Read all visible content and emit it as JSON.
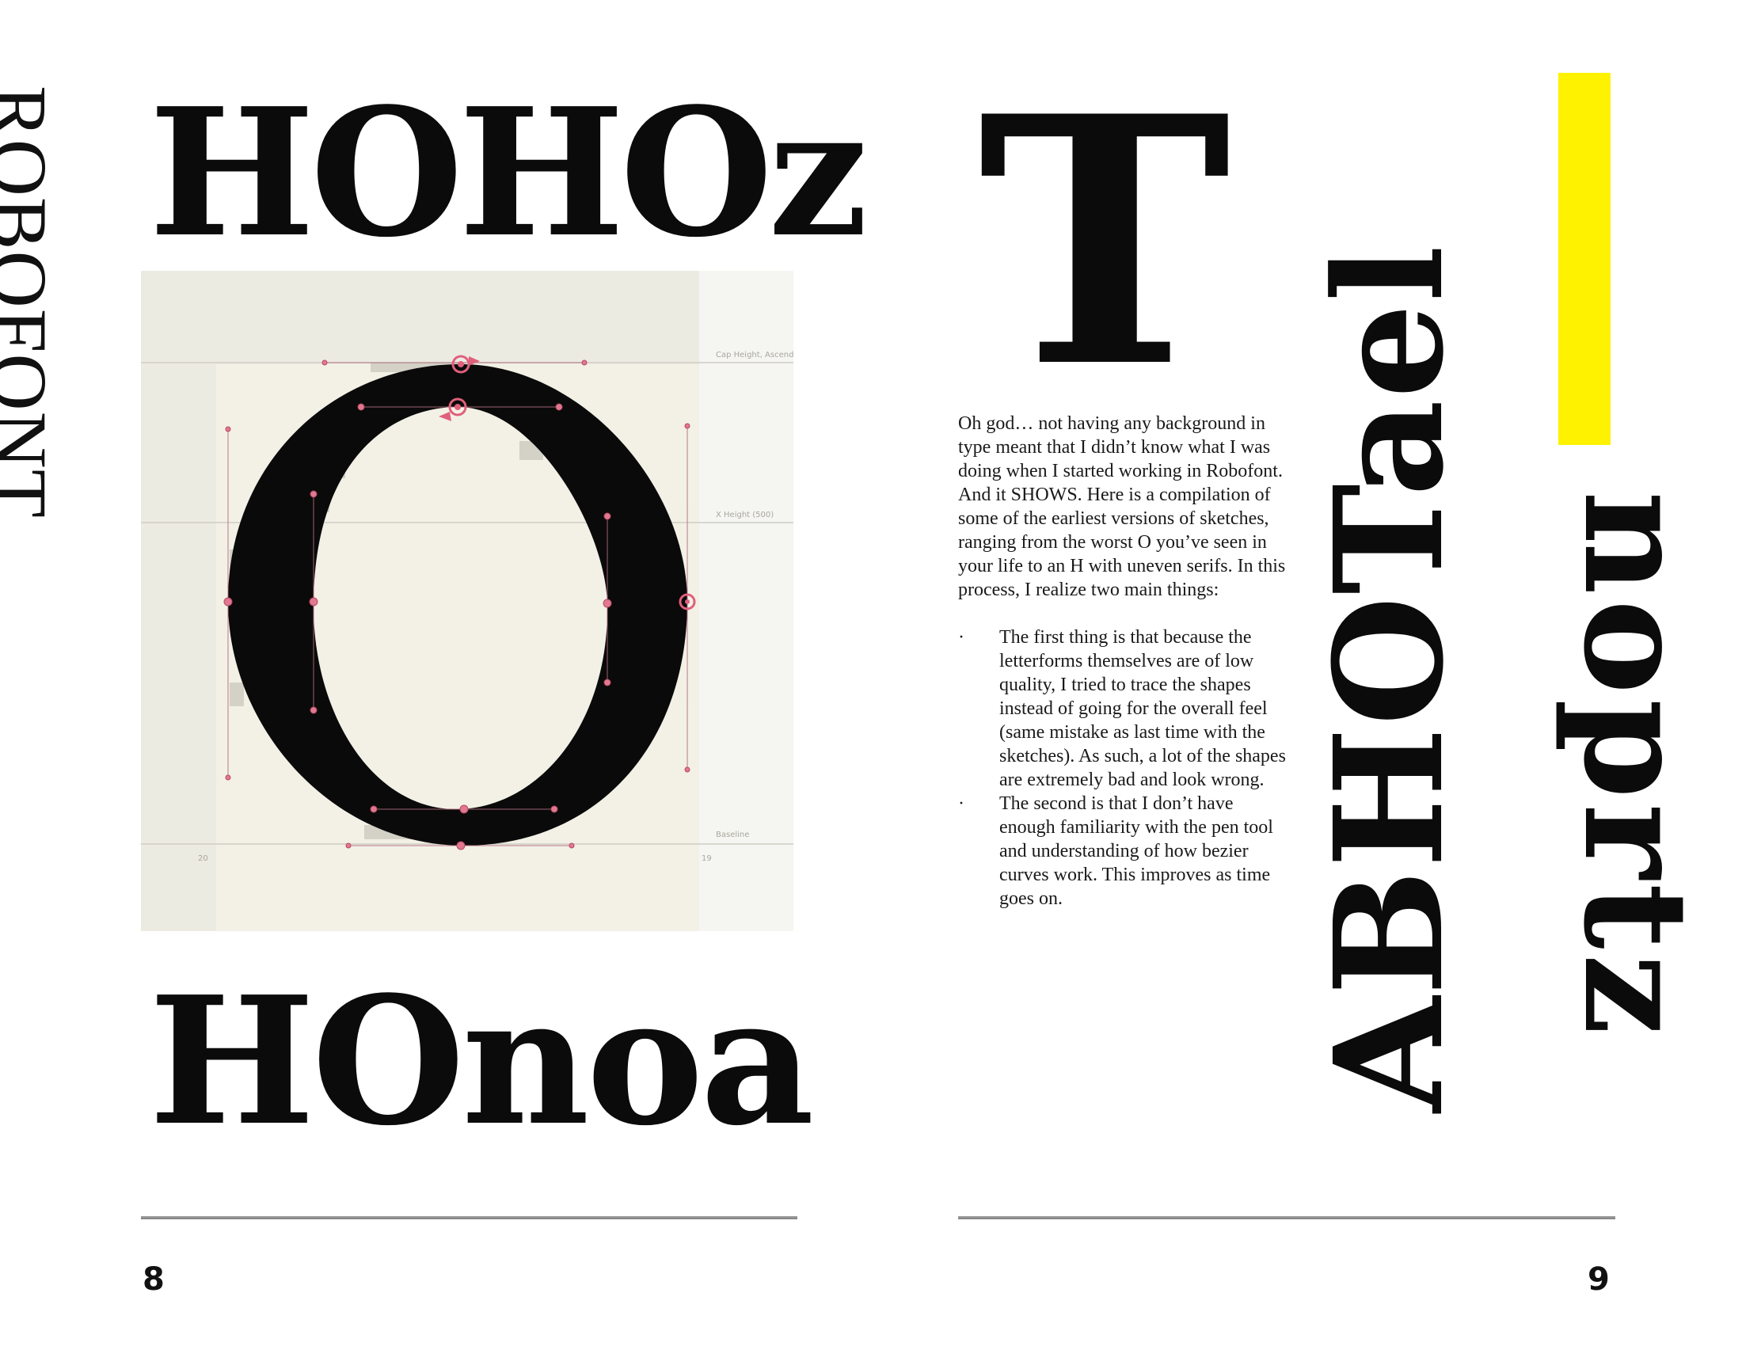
{
  "left_page": {
    "vertical_title": "ROBOFONT",
    "specimen_top": "HOHOz",
    "specimen_bottom": "HOnoa",
    "editor": {
      "guides": {
        "cap_height": "Cap Height, Ascender",
        "x_height": "X Height (500)",
        "baseline": "Baseline"
      },
      "glyph": "O",
      "sidebearing_left": "20",
      "sidebearing_right": "19"
    },
    "page_number": "8"
  },
  "right_page": {
    "big_letter": "T",
    "intro": "Oh god… not having any background in type meant that I didn’t know what I was doing when I started working in Robofont. And it SHOWS. Here is a compilation of some of the earliest versions of sketches, ranging from the worst O you’ve seen in your life to an H with uneven serifs. In this process, I realize two main things:",
    "bullet_symbol": "·",
    "bullets": [
      "The first thing is that because the letterforms themselves are of low quality, I tried to trace the shapes instead of going for the overall feel (same mistake as last time with the sketches). As such, a lot of the shapes are extremely bad and look wrong.",
      "The second is that I don’t have enough familiarity with the pen tool and understanding of how bezier curves work. This improves as time goes on."
    ],
    "vertical_specimen_1": "ABHOTael",
    "vertical_specimen_2": "noprtz",
    "accent_color": "#FFF200",
    "page_number": "9"
  }
}
